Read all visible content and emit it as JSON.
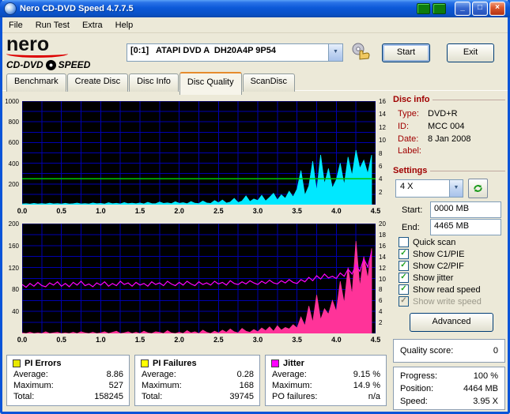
{
  "window": {
    "title": "Nero CD-DVD Speed 4.7.7.5"
  },
  "menu": {
    "items": [
      "File",
      "Run Test",
      "Extra",
      "Help"
    ]
  },
  "logo": {
    "nero": "nero",
    "cddvd": "CD-DVD",
    "speed": "SPEED"
  },
  "toolbar": {
    "drive": "[0:1]   ATAPI DVD A  DH20A4P 9P54",
    "start_label": "Start",
    "exit_label": "Exit"
  },
  "tabs": {
    "items": [
      "Benchmark",
      "Create Disc",
      "Disc Info",
      "Disc Quality",
      "ScanDisc"
    ],
    "active": "Disc Quality"
  },
  "disc_info": {
    "title": "Disc info",
    "rows": [
      {
        "label": "Type:",
        "value": "DVD+R"
      },
      {
        "label": "ID:",
        "value": "MCC 004"
      },
      {
        "label": "Date:",
        "value": "8 Jan 2008"
      },
      {
        "label": "Label:",
        "value": "",
        "redacted": true
      }
    ]
  },
  "settings": {
    "title": "Settings",
    "speed": "4 X",
    "start_label": "Start:",
    "start_value": "0000 MB",
    "end_label": "End:",
    "end_value": "4465 MB",
    "checkboxes": [
      {
        "label": "Quick scan",
        "checked": false,
        "disabled": false
      },
      {
        "label": "Show C1/PIE",
        "checked": true,
        "disabled": false
      },
      {
        "label": "Show C2/PIF",
        "checked": true,
        "disabled": false
      },
      {
        "label": "Show jitter",
        "checked": true,
        "disabled": false
      },
      {
        "label": "Show read speed",
        "checked": true,
        "disabled": false
      },
      {
        "label": "Show write speed",
        "checked": true,
        "disabled": true
      }
    ],
    "advanced_label": "Advanced"
  },
  "quality": {
    "label": "Quality score:",
    "value": "0"
  },
  "progress": {
    "rows": [
      {
        "label": "Progress:",
        "value": "100 %"
      },
      {
        "label": "Position:",
        "value": "4464 MB"
      },
      {
        "label": "Speed:",
        "value": "3.95 X"
      }
    ]
  },
  "stats": {
    "boxes": [
      {
        "title": "PI Errors",
        "color": "#e8e800",
        "rows": [
          {
            "label": "Average:",
            "value": "8.86"
          },
          {
            "label": "Maximum:",
            "value": "527"
          },
          {
            "label": "Total:",
            "value": "158245"
          }
        ]
      },
      {
        "title": "PI Failures",
        "color": "#ffff00",
        "rows": [
          {
            "label": "Average:",
            "value": "0.28"
          },
          {
            "label": "Maximum:",
            "value": "168"
          },
          {
            "label": "Total:",
            "value": "39745"
          }
        ]
      },
      {
        "title": "Jitter",
        "color": "#ff00ff",
        "rows": [
          {
            "label": "Average:",
            "value": "9.15 %"
          },
          {
            "label": "Maximum:",
            "value": "14.9 %"
          },
          {
            "label": "PO failures:",
            "value": "n/a"
          }
        ]
      }
    ]
  },
  "chart_data": [
    {
      "type": "area",
      "title": "PI Errors vs position (GB) with read speed",
      "bg": "#000000",
      "grid_color": "#0000b0",
      "grid_on": true,
      "x_max": 4.5,
      "grid_x_step": 0.25,
      "grid_y_divisions": 10,
      "left_max": 1000,
      "right_max": 16,
      "left_ticks": [
        1000,
        800,
        600,
        400,
        200
      ],
      "right_ticks": [
        16,
        14,
        12,
        10,
        8,
        6,
        4,
        2
      ],
      "x_ticks": [
        "0.0",
        "0.5",
        "1.0",
        "1.5",
        "2.0",
        "2.5",
        "3.0",
        "3.5",
        "4.0",
        "4.5"
      ],
      "series": [
        {
          "name": "PI Errors",
          "render": "area",
          "scale": "left",
          "color": "#00e8ff",
          "x_start": 0,
          "x_step": 0.05,
          "values": [
            6,
            9,
            5,
            12,
            7,
            10,
            6,
            14,
            8,
            11,
            7,
            13,
            6,
            9,
            15,
            8,
            11,
            7,
            16,
            9,
            12,
            7,
            18,
            9,
            13,
            8,
            20,
            10,
            14,
            9,
            16,
            8,
            22,
            11,
            9,
            25,
            12,
            17,
            10,
            28,
            13,
            19,
            9,
            30,
            14,
            11,
            35,
            16,
            12,
            40,
            18,
            45,
            15,
            25,
            60,
            20,
            35,
            85,
            30,
            55,
            40,
            90,
            35,
            70,
            110,
            45,
            95,
            60,
            130,
            75,
            150,
            330,
            90,
            180,
            420,
            130,
            480,
            200,
            350,
            160,
            240,
            400,
            190,
            460,
            280,
            527,
            350,
            430,
            300,
            480
          ]
        },
        {
          "name": "Read speed",
          "render": "hline",
          "scale": "right",
          "color": "#00c800",
          "const": 4.0
        }
      ]
    },
    {
      "type": "area",
      "title": "PI Failures and Jitter vs position (GB)",
      "bg": "#000000",
      "grid_color": "#0000b0",
      "grid_on": true,
      "x_max": 4.5,
      "grid_x_step": 0.25,
      "grid_y_divisions": 10,
      "left_max": 200,
      "right_max": 20,
      "left_ticks": [
        200,
        160,
        120,
        80,
        40
      ],
      "right_ticks": [
        20,
        18,
        16,
        14,
        12,
        10,
        8,
        6,
        4,
        2
      ],
      "x_ticks": [
        "0.0",
        "0.5",
        "1.0",
        "1.5",
        "2.0",
        "2.5",
        "3.0",
        "3.5",
        "4.0",
        "4.5"
      ],
      "series": [
        {
          "name": "PI Failures",
          "render": "area",
          "scale": "left",
          "color": "#ff3399",
          "x_start": 0,
          "x_step": 0.05,
          "values": [
            1,
            0,
            2,
            0,
            1,
            0,
            3,
            0,
            1,
            2,
            0,
            1,
            0,
            2,
            0,
            3,
            1,
            0,
            2,
            0,
            1,
            3,
            0,
            2,
            4,
            0,
            1,
            3,
            0,
            2,
            0,
            4,
            1,
            0,
            3,
            2,
            0,
            5,
            1,
            0,
            2,
            0,
            5,
            1,
            3,
            0,
            6,
            2,
            0,
            4,
            1,
            6,
            2,
            8,
            3,
            1,
            9,
            4,
            2,
            7,
            3,
            10,
            5,
            12,
            4,
            14,
            6,
            11,
            8,
            16,
            10,
            30,
            14,
            50,
            20,
            70,
            25,
            45,
            35,
            60,
            40,
            95,
            55,
            120,
            70,
            168,
            85,
            140,
            100,
            155
          ]
        },
        {
          "name": "Jitter %",
          "render": "line",
          "scale": "right",
          "color": "#ff00ff",
          "x_start": 0,
          "x_step": 0.05,
          "values": [
            8.9,
            8.4,
            9.1,
            8.6,
            9.3,
            8.7,
            8.5,
            9.2,
            8.8,
            9.4,
            8.6,
            9.1,
            8.5,
            9.3,
            8.8,
            9.5,
            8.7,
            9.0,
            8.5,
            9.2,
            8.8,
            9.4,
            8.6,
            9.1,
            8.7,
            9.5,
            8.9,
            9.2,
            8.6,
            9.3,
            8.8,
            9.1,
            8.6,
            9.4,
            8.9,
            9.2,
            8.7,
            9.5,
            9.0,
            8.7,
            9.3,
            8.8,
            9.5,
            9.0,
            8.7,
            9.4,
            8.9,
            9.2,
            8.8,
            9.5,
            9.0,
            9.3,
            8.8,
            9.6,
            9.1,
            8.9,
            9.4,
            9.0,
            9.6,
            9.2,
            8.9,
            9.5,
            9.1,
            9.7,
            9.2,
            9.0,
            9.6,
            9.2,
            9.8,
            9.3,
            9.1,
            9.8,
            9.4,
            10.2,
            9.6,
            10.5,
            9.9,
            10.8,
            10.1,
            10.4,
            10.0,
            11.0,
            10.4,
            11.7,
            10.8,
            12.5,
            11.3,
            13.6,
            12.1,
            14.9
          ]
        }
      ]
    }
  ]
}
